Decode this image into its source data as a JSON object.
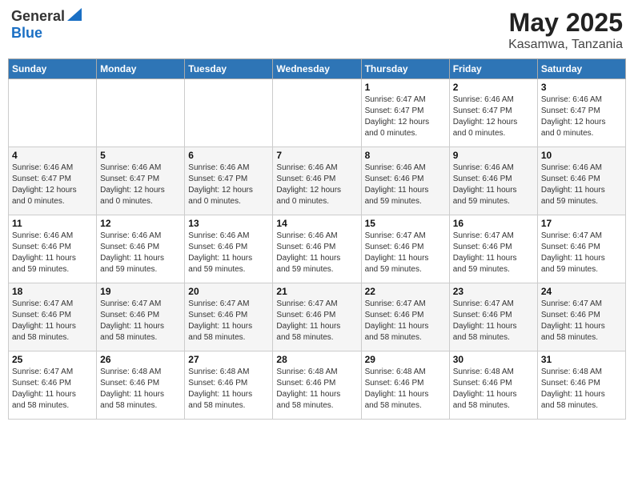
{
  "header": {
    "logo_general": "General",
    "logo_blue": "Blue",
    "month_title": "May 2025",
    "location": "Kasamwa, Tanzania"
  },
  "days_of_week": [
    "Sunday",
    "Monday",
    "Tuesday",
    "Wednesday",
    "Thursday",
    "Friday",
    "Saturday"
  ],
  "weeks": [
    [
      {
        "day": "",
        "info": ""
      },
      {
        "day": "",
        "info": ""
      },
      {
        "day": "",
        "info": ""
      },
      {
        "day": "",
        "info": ""
      },
      {
        "day": "1",
        "info": "Sunrise: 6:47 AM\nSunset: 6:47 PM\nDaylight: 12 hours\nand 0 minutes."
      },
      {
        "day": "2",
        "info": "Sunrise: 6:46 AM\nSunset: 6:47 PM\nDaylight: 12 hours\nand 0 minutes."
      },
      {
        "day": "3",
        "info": "Sunrise: 6:46 AM\nSunset: 6:47 PM\nDaylight: 12 hours\nand 0 minutes."
      }
    ],
    [
      {
        "day": "4",
        "info": "Sunrise: 6:46 AM\nSunset: 6:47 PM\nDaylight: 12 hours\nand 0 minutes."
      },
      {
        "day": "5",
        "info": "Sunrise: 6:46 AM\nSunset: 6:47 PM\nDaylight: 12 hours\nand 0 minutes."
      },
      {
        "day": "6",
        "info": "Sunrise: 6:46 AM\nSunset: 6:47 PM\nDaylight: 12 hours\nand 0 minutes."
      },
      {
        "day": "7",
        "info": "Sunrise: 6:46 AM\nSunset: 6:46 PM\nDaylight: 12 hours\nand 0 minutes."
      },
      {
        "day": "8",
        "info": "Sunrise: 6:46 AM\nSunset: 6:46 PM\nDaylight: 11 hours\nand 59 minutes."
      },
      {
        "day": "9",
        "info": "Sunrise: 6:46 AM\nSunset: 6:46 PM\nDaylight: 11 hours\nand 59 minutes."
      },
      {
        "day": "10",
        "info": "Sunrise: 6:46 AM\nSunset: 6:46 PM\nDaylight: 11 hours\nand 59 minutes."
      }
    ],
    [
      {
        "day": "11",
        "info": "Sunrise: 6:46 AM\nSunset: 6:46 PM\nDaylight: 11 hours\nand 59 minutes."
      },
      {
        "day": "12",
        "info": "Sunrise: 6:46 AM\nSunset: 6:46 PM\nDaylight: 11 hours\nand 59 minutes."
      },
      {
        "day": "13",
        "info": "Sunrise: 6:46 AM\nSunset: 6:46 PM\nDaylight: 11 hours\nand 59 minutes."
      },
      {
        "day": "14",
        "info": "Sunrise: 6:46 AM\nSunset: 6:46 PM\nDaylight: 11 hours\nand 59 minutes."
      },
      {
        "day": "15",
        "info": "Sunrise: 6:47 AM\nSunset: 6:46 PM\nDaylight: 11 hours\nand 59 minutes."
      },
      {
        "day": "16",
        "info": "Sunrise: 6:47 AM\nSunset: 6:46 PM\nDaylight: 11 hours\nand 59 minutes."
      },
      {
        "day": "17",
        "info": "Sunrise: 6:47 AM\nSunset: 6:46 PM\nDaylight: 11 hours\nand 59 minutes."
      }
    ],
    [
      {
        "day": "18",
        "info": "Sunrise: 6:47 AM\nSunset: 6:46 PM\nDaylight: 11 hours\nand 58 minutes."
      },
      {
        "day": "19",
        "info": "Sunrise: 6:47 AM\nSunset: 6:46 PM\nDaylight: 11 hours\nand 58 minutes."
      },
      {
        "day": "20",
        "info": "Sunrise: 6:47 AM\nSunset: 6:46 PM\nDaylight: 11 hours\nand 58 minutes."
      },
      {
        "day": "21",
        "info": "Sunrise: 6:47 AM\nSunset: 6:46 PM\nDaylight: 11 hours\nand 58 minutes."
      },
      {
        "day": "22",
        "info": "Sunrise: 6:47 AM\nSunset: 6:46 PM\nDaylight: 11 hours\nand 58 minutes."
      },
      {
        "day": "23",
        "info": "Sunrise: 6:47 AM\nSunset: 6:46 PM\nDaylight: 11 hours\nand 58 minutes."
      },
      {
        "day": "24",
        "info": "Sunrise: 6:47 AM\nSunset: 6:46 PM\nDaylight: 11 hours\nand 58 minutes."
      }
    ],
    [
      {
        "day": "25",
        "info": "Sunrise: 6:47 AM\nSunset: 6:46 PM\nDaylight: 11 hours\nand 58 minutes."
      },
      {
        "day": "26",
        "info": "Sunrise: 6:48 AM\nSunset: 6:46 PM\nDaylight: 11 hours\nand 58 minutes."
      },
      {
        "day": "27",
        "info": "Sunrise: 6:48 AM\nSunset: 6:46 PM\nDaylight: 11 hours\nand 58 minutes."
      },
      {
        "day": "28",
        "info": "Sunrise: 6:48 AM\nSunset: 6:46 PM\nDaylight: 11 hours\nand 58 minutes."
      },
      {
        "day": "29",
        "info": "Sunrise: 6:48 AM\nSunset: 6:46 PM\nDaylight: 11 hours\nand 58 minutes."
      },
      {
        "day": "30",
        "info": "Sunrise: 6:48 AM\nSunset: 6:46 PM\nDaylight: 11 hours\nand 58 minutes."
      },
      {
        "day": "31",
        "info": "Sunrise: 6:48 AM\nSunset: 6:46 PM\nDaylight: 11 hours\nand 58 minutes."
      }
    ]
  ]
}
